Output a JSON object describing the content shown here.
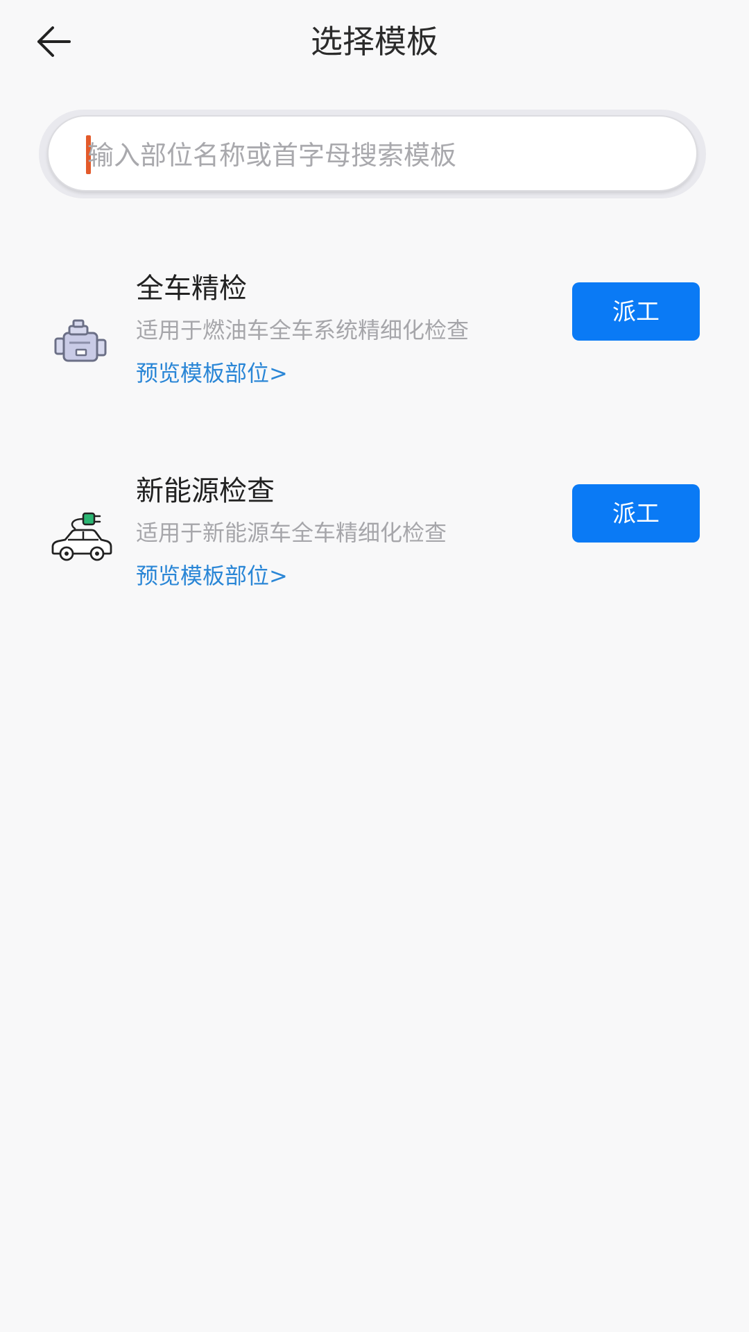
{
  "header": {
    "title": "选择模板"
  },
  "search": {
    "placeholder": "输入部位名称或首字母搜索模板",
    "value": ""
  },
  "templates": [
    {
      "title": "全车精检",
      "description": "适用于燃油车全车系统精细化检查",
      "preview_link": "预览模板部位>",
      "button_label": "派工",
      "icon": "engine-icon"
    },
    {
      "title": "新能源检查",
      "description": "适用于新能源车全车精细化检查",
      "preview_link": "预览模板部位>",
      "button_label": "派工",
      "icon": "electric-car-icon"
    }
  ],
  "colors": {
    "accent": "#0a7af5",
    "link": "#2a86d6",
    "caret": "#e35a2a"
  }
}
